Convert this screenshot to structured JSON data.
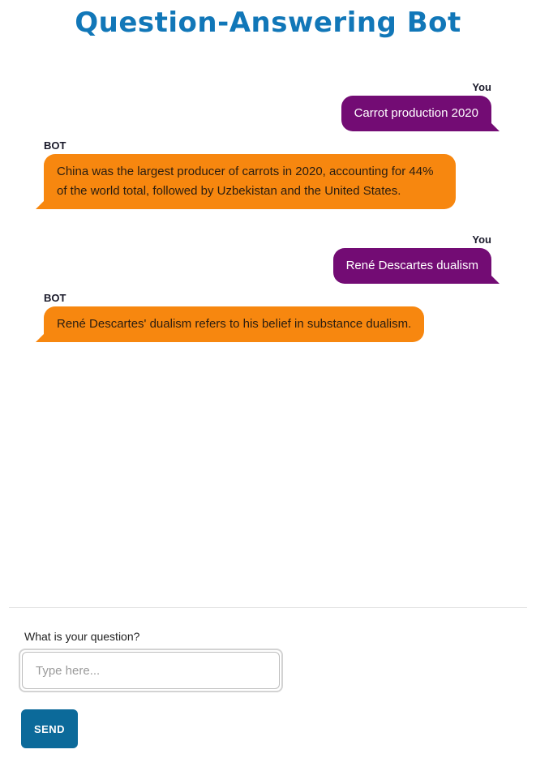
{
  "app": {
    "title": "Question-Answering Bot"
  },
  "messages": [
    {
      "sender": "You",
      "role": "user",
      "text": "Carrot production 2020"
    },
    {
      "sender": "BOT",
      "role": "bot",
      "text": "China was the largest producer of carrots in 2020, accounting for 44% of the world total, followed by Uzbekistan and the United States."
    },
    {
      "sender": "You",
      "role": "user",
      "text": "René Descartes dualism"
    },
    {
      "sender": "BOT",
      "role": "bot",
      "text": "René Descartes' dualism refers to his belief in substance dualism."
    }
  ],
  "form": {
    "label": "What is your question?",
    "placeholder": "Type here...",
    "value": "",
    "send_label": "SEND"
  },
  "colors": {
    "title": "#1177b8",
    "user_bubble": "#730c74",
    "bot_bubble": "#f7870f",
    "send_button": "#0c6a9a"
  }
}
